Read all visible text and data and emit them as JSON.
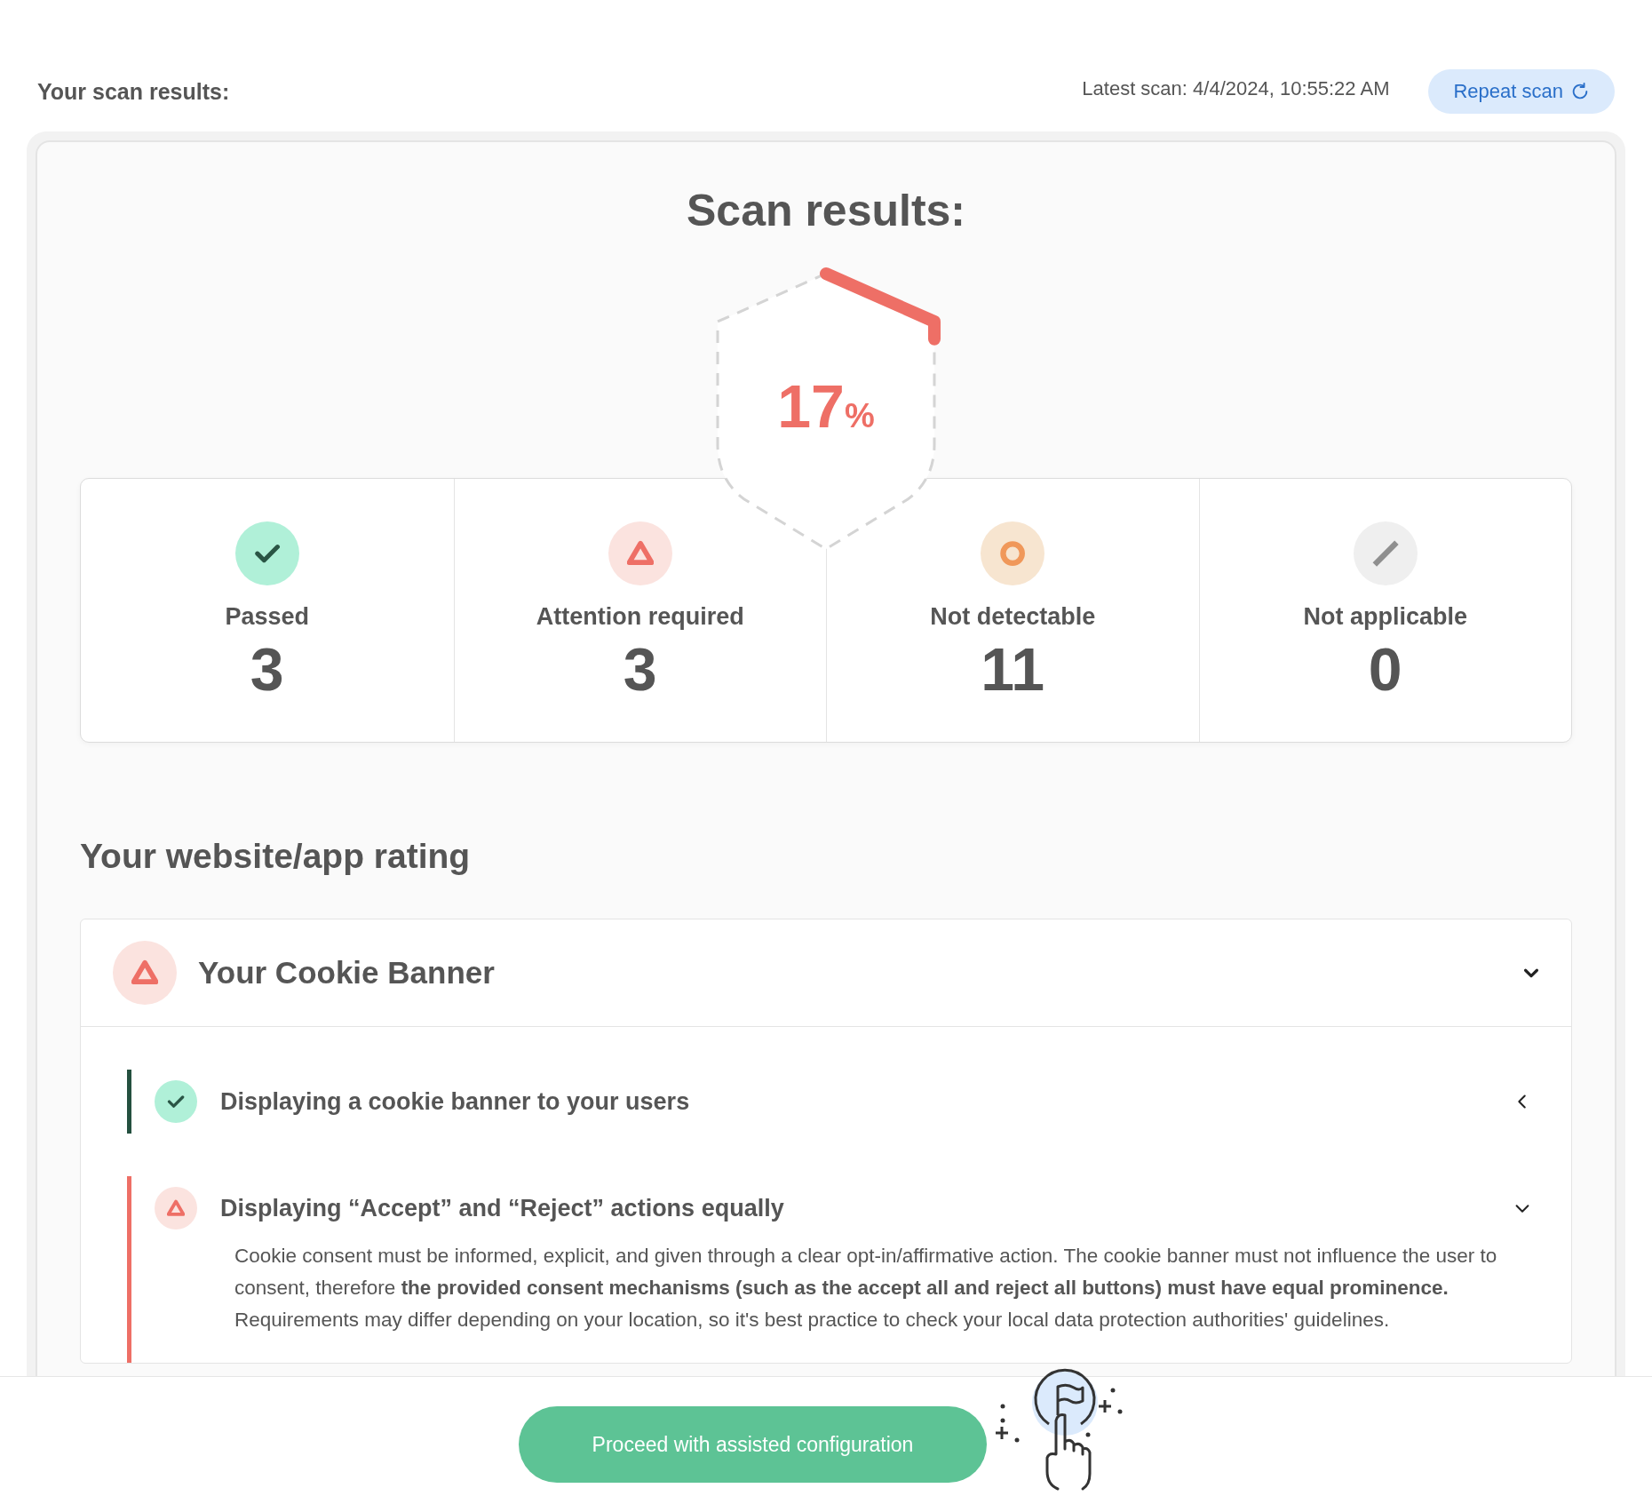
{
  "header": {
    "title": "Your scan results:",
    "latest_scan": "Latest scan: 4/4/2024, 10:55:22 AM",
    "repeat_button": "Repeat scan"
  },
  "summary": {
    "title": "Scan results:",
    "score": "17",
    "unit": "%"
  },
  "stats": [
    {
      "kind": "passed",
      "label": "Passed",
      "count": "3"
    },
    {
      "kind": "attention",
      "label": "Attention required",
      "count": "3"
    },
    {
      "kind": "not_detectable",
      "label": "Not detectable",
      "count": "11"
    },
    {
      "kind": "not_applicable",
      "label": "Not applicable",
      "count": "0"
    }
  ],
  "rating": {
    "title": "Your website/app rating",
    "sections": [
      {
        "kind": "attention",
        "title": "Your Cookie Banner",
        "expanded": true,
        "items": [
          {
            "kind": "passed",
            "title": "Displaying a cookie banner to your users",
            "expanded": false
          },
          {
            "kind": "attention",
            "title": "Displaying “Accept” and “Reject” actions equally",
            "expanded": true,
            "description": [
              "Cookie consent must be informed, explicit, and given through a clear opt-in/affirmative action. The cookie banner must not influence the user to consent, therefore **the provided consent mechanisms (such as the accept all and reject all buttons) must have equal prominence.**",
              "Requirements may differ depending on your location, so it's best practice to check your local data protection authorities' guidelines."
            ]
          }
        ]
      }
    ]
  },
  "footer": {
    "button": "Proceed with assisted configuration"
  }
}
